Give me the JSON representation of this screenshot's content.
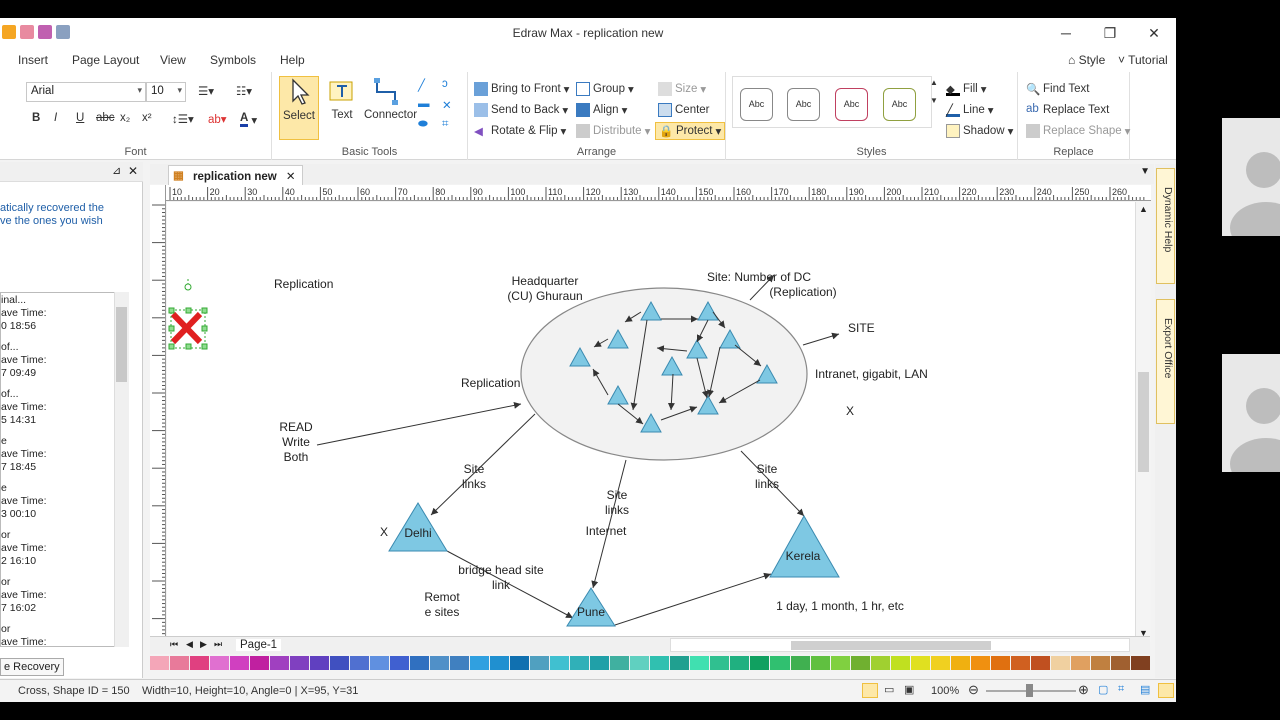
{
  "window": {
    "title": "Edraw Max - replication new"
  },
  "menu": {
    "items": [
      "Insert",
      "Page Layout",
      "View",
      "Symbols",
      "Help"
    ],
    "style": "Style",
    "tutorial": "Tutorial"
  },
  "font": {
    "family": "Arial",
    "size": "10",
    "group_label": "Font"
  },
  "basic_tools": {
    "select": "Select",
    "text": "Text",
    "connector": "Connector",
    "group_label": "Basic Tools"
  },
  "arrange": {
    "bring_to_front": "Bring to Front",
    "send_to_back": "Send to Back",
    "rotate_flip": "Rotate & Flip",
    "group": "Group",
    "align": "Align",
    "distribute": "Distribute",
    "size": "Size",
    "center": "Center",
    "protect": "Protect",
    "group_label": "Arrange"
  },
  "styles": {
    "swatch": "Abc",
    "fill": "Fill",
    "line": "Line",
    "shadow": "Shadow",
    "group_label": "Styles"
  },
  "replace": {
    "find_text": "Find Text",
    "replace_text": "Replace Text",
    "replace_shape": "Replace Shape",
    "group_label": "Replace"
  },
  "left_panel": {
    "message_line1": "atically recovered the",
    "message_line2": "ve the ones you wish",
    "items": [
      {
        "line1": "inal...",
        "line2": "ave Time:",
        "line3": "0 18:56"
      },
      {
        "line1": "of...",
        "line2": "ave Time:",
        "line3": "7 09:49"
      },
      {
        "line1": "of...",
        "line2": "ave Time:",
        "line3": "5 14:31"
      },
      {
        "line1": "e",
        "line2": "ave Time:",
        "line3": "7 18:45"
      },
      {
        "line1": "e",
        "line2": "ave Time:",
        "line3": "3 00:10"
      },
      {
        "line1": "or",
        "line2": "ave Time:",
        "line3": "2 16:10"
      },
      {
        "line1": "or",
        "line2": "ave Time:",
        "line3": "7 16:02"
      },
      {
        "line1": "or",
        "line2": "ave Time:",
        "line3": ""
      }
    ],
    "recovery_button": "e Recovery"
  },
  "document_tab": "replication new",
  "ruler_marks": [
    "10",
    "20",
    "30",
    "40",
    "50",
    "60",
    "70",
    "80",
    "90",
    "100",
    "110",
    "120",
    "130",
    "140",
    "150",
    "160",
    "170",
    "180",
    "190",
    "200",
    "210",
    "220",
    "230",
    "240",
    "250",
    "260"
  ],
  "diagram": {
    "replication_title": "Replication",
    "hq_line1": "Headquarter",
    "hq_line2": "(CU) Ghuraun",
    "site_dc_line1": "Site: Number of DC",
    "site_dc_line2": "(Replication)",
    "site": "SITE",
    "intranet": "Intranet, gigabit, LAN",
    "x_mark": "X",
    "replication_label": "Replication",
    "read": "READ",
    "write": "Write",
    "both": "Both",
    "site_links_a1": "Site",
    "site_links_a2": "links",
    "site_links_b1": "Site",
    "site_links_b2": "links",
    "site_links_c1": "Site",
    "site_links_c2": "links",
    "internet": "Internet",
    "delhi": "Delhi",
    "delhi_x": "X",
    "bridge1": "bridge head site",
    "bridge2": "link",
    "remote1": "Remot",
    "remote2": "e sites",
    "pune": "Pune",
    "kerela": "Kerela",
    "durations": "1 day, 1 month, 1 hr, etc"
  },
  "page_tab": "Page-1",
  "dock": {
    "dynamic_help": "Dynamic Help",
    "export_office": "Export Office"
  },
  "status": {
    "shape": "Cross, Shape ID = 150",
    "dims": "Width=10, Height=10, Angle=0 | X=95, Y=31",
    "zoom": "100%"
  },
  "colors": {
    "selected_tool": "#fde8a8",
    "triangle_fill": "#7ec8e3",
    "link_text": "#1f5fa8"
  }
}
